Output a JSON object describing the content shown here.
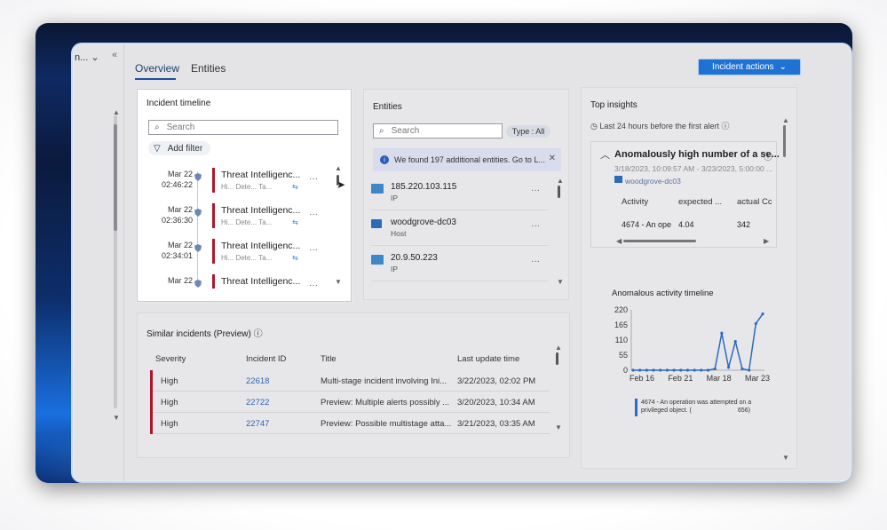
{
  "left_rail": {
    "label": "n...",
    "chevron": "chevron-down-icon",
    "collapse": "«"
  },
  "tabs": [
    {
      "label": "Overview"
    },
    {
      "label": "Entities"
    }
  ],
  "incident_actions": {
    "label": "Incident actions"
  },
  "timeline": {
    "title": "Incident timeline",
    "search_placeholder": "Search",
    "add_filter": "Add filter",
    "items": [
      {
        "date": "Mar 22",
        "time": "02:46:22",
        "title": "Threat Intelligenc...",
        "sub": "Hi...   Dete...   Ta..."
      },
      {
        "date": "Mar 22",
        "time": "02:36:30",
        "title": "Threat Intelligenc...",
        "sub": "Hi...   Dete...   Ta..."
      },
      {
        "date": "Mar 22",
        "time": "02:34:01",
        "title": "Threat Intelligenc...",
        "sub": "Hi...   Dete...   Ta..."
      },
      {
        "date": "Mar 22",
        "time": "",
        "title": "Threat Intelligenc...",
        "sub": ""
      }
    ]
  },
  "entities": {
    "title": "Entities",
    "search_placeholder": "Search",
    "type_filter": "Type : All",
    "banner": "We found 197 additional entities. Go to L...",
    "items": [
      {
        "name": "185.220.103.115",
        "type": "IP"
      },
      {
        "name": "woodgrove-dc03",
        "type": "Host"
      },
      {
        "name": "20.9.50.223",
        "type": "IP"
      }
    ]
  },
  "insights": {
    "title": "Top insights",
    "subtitle": "Last 24 hours before the first alert",
    "anomaly": {
      "title": "Anomalously high number of a se...",
      "dates": "3/18/2023, 10:09:57 AM - 3/23/2023, 5:00:00 ...",
      "host": "woodgrove-dc03",
      "headers": [
        "Activity",
        "expected ...",
        "actual Cc"
      ],
      "row": [
        "4674 - An ope",
        "4.04",
        "342"
      ]
    },
    "chart_title": "Anomalous activity timeline",
    "legend": "4674 - An operation was attempted on a privileged object. (",
    "legend_count": "656)"
  },
  "chart_data": {
    "type": "line",
    "yticks": [
      "220",
      "165",
      "110",
      "55",
      "0"
    ],
    "xticks": [
      "Feb 16",
      "Feb 21",
      "Mar 18",
      "Mar 23"
    ],
    "ylim": [
      0,
      220
    ],
    "values": [
      0,
      0,
      0,
      0,
      0,
      0,
      0,
      0,
      0,
      0,
      0,
      0,
      5,
      135,
      10,
      105,
      5,
      0,
      170,
      205
    ],
    "color": "#2a6bc4"
  },
  "similar": {
    "title": "Similar incidents (Preview)",
    "headers": [
      "Severity",
      "Incident ID",
      "Title",
      "Last update time"
    ],
    "rows": [
      {
        "severity": "High",
        "id": "22618",
        "title": "Multi-stage incident involving Ini...",
        "updated": "3/22/2023, 02:02 PM"
      },
      {
        "severity": "High",
        "id": "22722",
        "title": "Preview: Multiple alerts possibly ...",
        "updated": "3/20/2023, 10:34 AM"
      },
      {
        "severity": "High",
        "id": "22747",
        "title": "Preview: Possible multistage atta...",
        "updated": "3/21/2023, 03:35 AM"
      }
    ]
  },
  "colors": {
    "accent": "#1f72d4",
    "severity_high": "#b0152a",
    "link": "#2a64b0"
  }
}
